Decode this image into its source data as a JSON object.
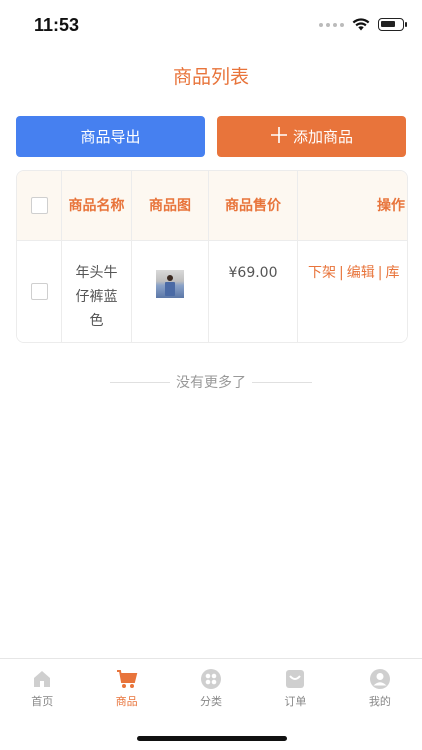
{
  "status": {
    "time": "11:53"
  },
  "page": {
    "title": "商品列表"
  },
  "actions": {
    "export_label": "商品导出",
    "add_label": "添加商品",
    "add_icon": "plus-icon"
  },
  "table": {
    "headers": {
      "name": "商品名称",
      "image": "商品图",
      "price": "商品售价",
      "ops": "操作"
    },
    "rows": [
      {
        "name": "年头牛仔裤蓝色",
        "price": "¥69.00",
        "ops": [
          "下架",
          "编辑",
          "库"
        ]
      }
    ]
  },
  "footer": {
    "no_more": "没有更多了"
  },
  "tabbar": {
    "items": [
      {
        "label": "首页",
        "icon": "home-icon"
      },
      {
        "label": "商品",
        "icon": "cart-icon",
        "active": true
      },
      {
        "label": "分类",
        "icon": "category-icon"
      },
      {
        "label": "订单",
        "icon": "order-icon"
      },
      {
        "label": "我的",
        "icon": "profile-icon"
      }
    ]
  },
  "colors": {
    "accent": "#E8743B",
    "primary": "#4680F0",
    "header_bg": "#FDF8F1"
  }
}
